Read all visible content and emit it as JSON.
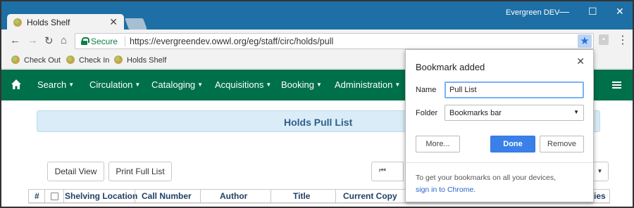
{
  "browser": {
    "tab_title": "Holds Shelf",
    "profile_name": "Evergreen DEV",
    "secure_label": "Secure",
    "url": "https://evergreendev.owwl.org/eg/staff/circ/holds/pull",
    "window_controls": [
      "—",
      "☐",
      "✕"
    ]
  },
  "bookmarks_bar": {
    "items": [
      {
        "label": "Check Out"
      },
      {
        "label": "Check In"
      },
      {
        "label": "Holds Shelf"
      }
    ]
  },
  "app_nav": {
    "items": [
      {
        "label": "Search"
      },
      {
        "label": "Circulation"
      },
      {
        "label": "Cataloging"
      },
      {
        "label": "Acquisitions"
      },
      {
        "label": "Booking"
      },
      {
        "label": "Administration"
      }
    ]
  },
  "main": {
    "panel_title": "Holds Pull List",
    "detail_view_label": "Detail View",
    "print_full_list_label": "Print Full List",
    "columns": [
      "#",
      "Shelving Location",
      "Call Number",
      "Author",
      "Title",
      "Current Copy",
      "ies"
    ]
  },
  "bookmark_popup": {
    "title": "Bookmark added",
    "name_label": "Name",
    "name_value": "Pull List",
    "folder_label": "Folder",
    "folder_value": "Bookmarks bar",
    "more_label": "More...",
    "done_label": "Done",
    "remove_label": "Remove",
    "footer_text": "To get your bookmarks on all your devices,",
    "footer_link": "sign in to Chrome",
    "footer_suffix": "."
  },
  "colors": {
    "titlebar": "#1d6fa5",
    "app_nav": "#00704a",
    "panel_header": "#d9ecf7",
    "primary_button": "#3a80e8"
  }
}
